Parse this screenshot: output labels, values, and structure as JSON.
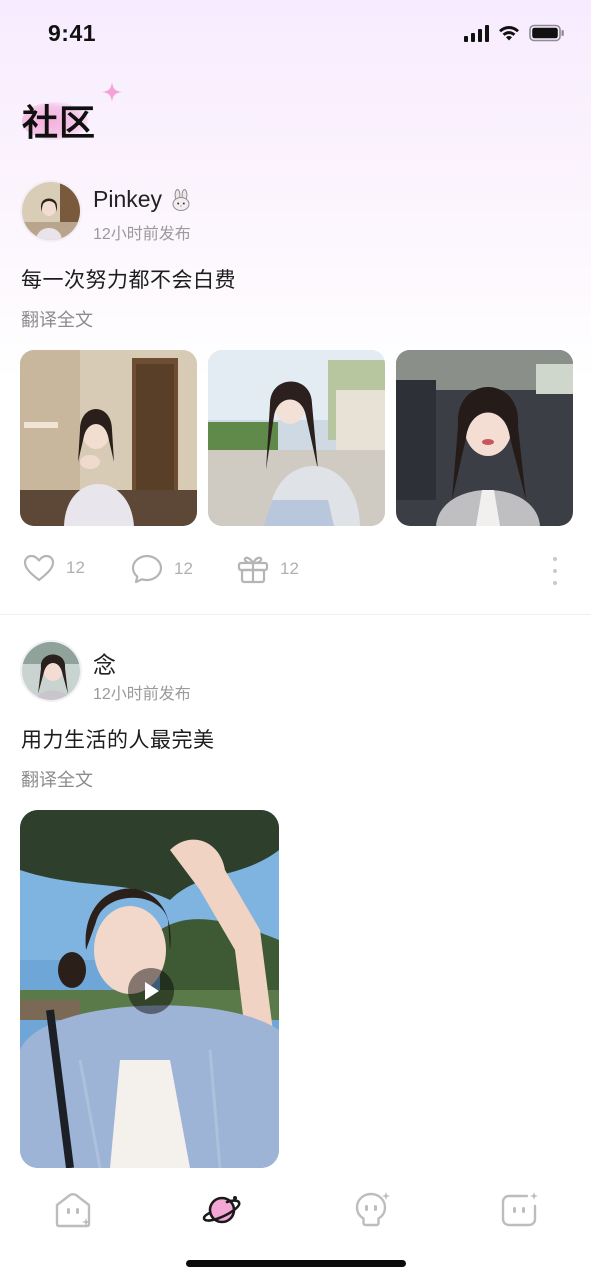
{
  "status_bar": {
    "time": "9:41"
  },
  "page": {
    "title": "社区"
  },
  "posts": [
    {
      "username": "Pinkey",
      "time": "12小时前发布",
      "text": "每一次努力都不会白费",
      "translate_label": "翻译全文",
      "likes": "12",
      "comments": "12",
      "gifts": "12"
    },
    {
      "username": "念",
      "time": "12小时前发布",
      "text": "用力生活的人最完美",
      "translate_label": "翻译全文"
    }
  ],
  "tab_bar": {
    "tabs": [
      {
        "icon": "home-face-icon",
        "active": false
      },
      {
        "icon": "planet-icon",
        "active": true
      },
      {
        "icon": "bulb-icon",
        "active": false
      },
      {
        "icon": "message-face-icon",
        "active": false
      }
    ]
  },
  "colors": {
    "accent": "#f06bb8",
    "active_tab": "#1a1a1a",
    "inactive_tab": "#bdbdbd"
  }
}
